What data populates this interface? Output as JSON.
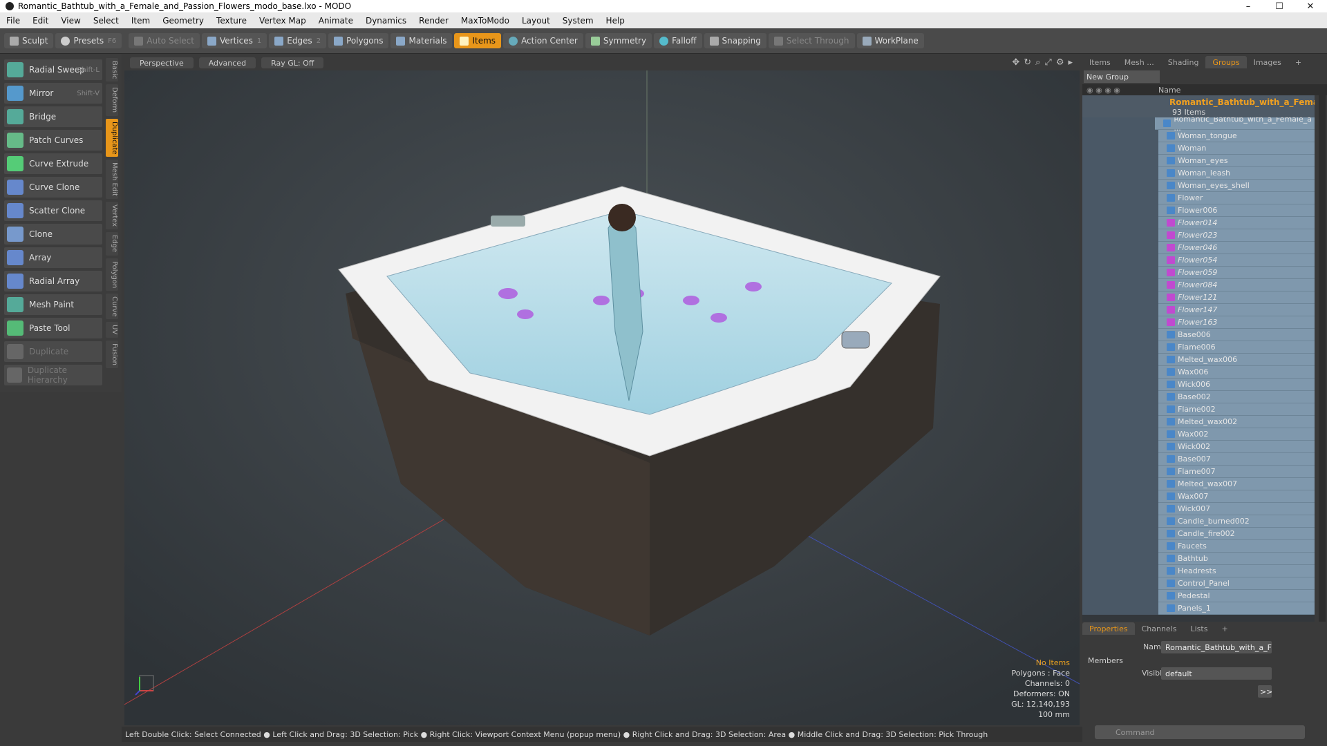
{
  "window": {
    "title": "Romantic_Bathtub_with_a_Female_and_Passion_Flowers_modo_base.lxo - MODO",
    "minimize": "–",
    "maximize": "☐",
    "close": "✕"
  },
  "menu": [
    "File",
    "Edit",
    "View",
    "Select",
    "Item",
    "Geometry",
    "Texture",
    "Vertex Map",
    "Animate",
    "Dynamics",
    "Render",
    "MaxToModo",
    "Layout",
    "System",
    "Help"
  ],
  "toolbar": {
    "sculpt": "Sculpt",
    "presets": "Presets",
    "presets_key": "F6",
    "auto_select": "Auto Select",
    "vertices": "Vertices",
    "vertices_count": "1",
    "edges": "Edges",
    "edges_count": "2",
    "polygons": "Polygons",
    "materials": "Materials",
    "items": "Items",
    "action_center": "Action Center",
    "symmetry": "Symmetry",
    "falloff": "Falloff",
    "snapping": "Snapping",
    "select_through": "Select Through",
    "workplane": "WorkPlane"
  },
  "tools": [
    {
      "label": "Radial Sweep",
      "shortcut": "Shift-L"
    },
    {
      "label": "Mirror",
      "shortcut": "Shift-V"
    },
    {
      "label": "Bridge",
      "shortcut": ""
    },
    {
      "label": "Patch Curves",
      "shortcut": ""
    },
    {
      "label": "Curve Extrude",
      "shortcut": ""
    },
    {
      "label": "Curve Clone",
      "shortcut": ""
    },
    {
      "label": "Scatter Clone",
      "shortcut": ""
    },
    {
      "label": "Clone",
      "shortcut": ""
    },
    {
      "label": "Array",
      "shortcut": ""
    },
    {
      "label": "Radial Array",
      "shortcut": ""
    },
    {
      "label": "Mesh Paint",
      "shortcut": ""
    },
    {
      "label": "Paste Tool",
      "shortcut": ""
    },
    {
      "label": "Duplicate",
      "shortcut": ""
    },
    {
      "label": "Duplicate Hierarchy",
      "shortcut": ""
    }
  ],
  "vtabs": [
    "Basic",
    "Deform",
    "Duplicate",
    "Mesh Edit",
    "Vertex",
    "Edge",
    "Polygon",
    "Curve",
    "UV",
    "Fusion"
  ],
  "viewport": {
    "perspective": "Perspective",
    "advanced": "Advanced",
    "raygl": "Ray GL: Off",
    "hud_no_items": "No Items",
    "hud_polygons": "Polygons : Face",
    "hud_channels": "Channels: 0",
    "hud_deformers": "Deformers: ON",
    "hud_gl": "GL: 12,140,193",
    "hud_scale": "100 mm"
  },
  "status": "Left Double Click: Select Connected ● Left Click and Drag: 3D Selection: Pick ● Right Click: Viewport Context Menu (popup menu) ● Right Click and Drag: 3D Selection: Area ● Middle Click and Drag: 3D Selection: Pick Through",
  "right_tabs": [
    "Items",
    "Mesh ...",
    "Shading",
    "Groups",
    "Images"
  ],
  "new_group": "New Group",
  "name_col": "Name",
  "group": {
    "name": "Romantic_Bathtub_with_a_Femal...",
    "count": "93 Items"
  },
  "items": [
    {
      "name": "Romantic_Bathtub_with_a_Female_a ...",
      "italic": false
    },
    {
      "name": "Woman_tongue",
      "italic": false
    },
    {
      "name": "Woman",
      "italic": false
    },
    {
      "name": "Woman_eyes",
      "italic": false
    },
    {
      "name": "Woman_leash",
      "italic": false
    },
    {
      "name": "Woman_eyes_shell",
      "italic": false
    },
    {
      "name": "Flower",
      "italic": false
    },
    {
      "name": "Flower006",
      "italic": false
    },
    {
      "name": "Flower014",
      "italic": true
    },
    {
      "name": "Flower023",
      "italic": true
    },
    {
      "name": "Flower046",
      "italic": true
    },
    {
      "name": "Flower054",
      "italic": true
    },
    {
      "name": "Flower059",
      "italic": true
    },
    {
      "name": "Flower084",
      "italic": true
    },
    {
      "name": "Flower121",
      "italic": true
    },
    {
      "name": "Flower147",
      "italic": true
    },
    {
      "name": "Flower163",
      "italic": true
    },
    {
      "name": "Base006",
      "italic": false
    },
    {
      "name": "Flame006",
      "italic": false
    },
    {
      "name": "Melted_wax006",
      "italic": false
    },
    {
      "name": "Wax006",
      "italic": false
    },
    {
      "name": "Wick006",
      "italic": false
    },
    {
      "name": "Base002",
      "italic": false
    },
    {
      "name": "Flame002",
      "italic": false
    },
    {
      "name": "Melted_wax002",
      "italic": false
    },
    {
      "name": "Wax002",
      "italic": false
    },
    {
      "name": "Wick002",
      "italic": false
    },
    {
      "name": "Base007",
      "italic": false
    },
    {
      "name": "Flame007",
      "italic": false
    },
    {
      "name": "Melted_wax007",
      "italic": false
    },
    {
      "name": "Wax007",
      "italic": false
    },
    {
      "name": "Wick007",
      "italic": false
    },
    {
      "name": "Candle_burned002",
      "italic": false
    },
    {
      "name": "Candle_fire002",
      "italic": false
    },
    {
      "name": "Faucets",
      "italic": false
    },
    {
      "name": "Bathtub",
      "italic": false
    },
    {
      "name": "Headrests",
      "italic": false
    },
    {
      "name": "Control_Panel",
      "italic": false
    },
    {
      "name": "Pedestal",
      "italic": false
    },
    {
      "name": "Panels_1",
      "italic": false
    }
  ],
  "props_tabs": [
    "Properties",
    "Channels",
    "Lists"
  ],
  "props": {
    "name_label": "Name",
    "name_value": "Romantic_Bathtub_with_a_Female_anc",
    "members": "Members",
    "visible_label": "Visible",
    "visible_value": "default",
    "more": ">>",
    "command_placeholder": "Command"
  }
}
